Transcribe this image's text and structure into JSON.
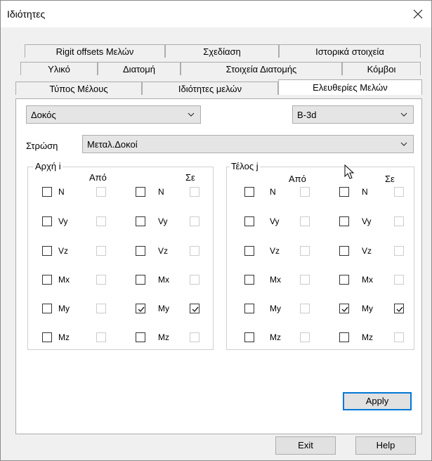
{
  "window": {
    "title": "Ιδιότητες"
  },
  "tabs": {
    "row1": [
      "Rigit offsets Μελών",
      "Σχεδίαση",
      "Ιστορικά στοιχεία"
    ],
    "row2": [
      "Υλικό",
      "Διατομή",
      "Στοιχεία Διατομής",
      "Κόμβοι"
    ],
    "row3": [
      "Τύπος Μέλους",
      "Ιδιότητες μελών",
      "Ελευθερίες Μελών"
    ],
    "active": "Ελευθερίες Μελών"
  },
  "panel": {
    "member_type_value": "Δοκός",
    "section_value": "B-3d",
    "layer_label": "Στρώση",
    "layer_value": "Μεταλ.Δοκοί",
    "start_group": {
      "title": "Αρχή i",
      "from_label": "Από",
      "to_label": "Σε",
      "rows": [
        "N",
        "Vy",
        "Vz",
        "Mx",
        "My",
        "Mz"
      ],
      "from_checked": [
        false,
        false,
        false,
        false,
        false,
        false
      ],
      "to_checked": [
        false,
        false,
        false,
        false,
        true,
        false
      ],
      "to_enabled_checked": [
        false,
        false,
        false,
        false,
        true,
        false
      ]
    },
    "end_group": {
      "title": "Τέλος j",
      "from_label": "Από",
      "to_label": "Σε",
      "rows": [
        "N",
        "Vy",
        "Vz",
        "Mx",
        "My",
        "Mz"
      ],
      "from_checked": [
        false,
        false,
        false,
        false,
        false,
        false
      ],
      "to_checked": [
        false,
        false,
        false,
        false,
        true,
        false
      ],
      "to_enabled_checked": [
        false,
        false,
        false,
        false,
        true,
        false
      ]
    },
    "apply_label": "Apply"
  },
  "footer": {
    "exit_label": "Exit",
    "help_label": "Help"
  }
}
